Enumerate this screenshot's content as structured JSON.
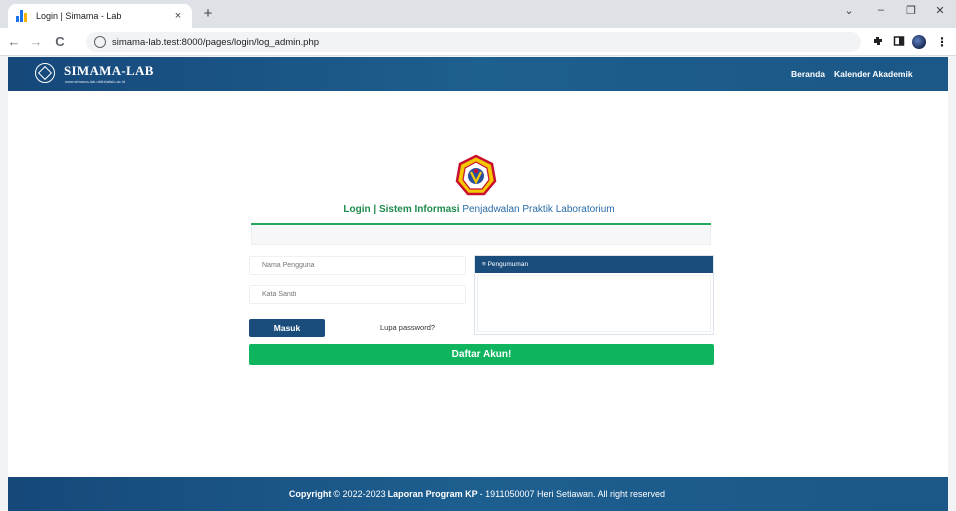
{
  "browser": {
    "tab_title": "Login | Simama - Lab",
    "tab_close": "×",
    "new_tab": "+",
    "url": "simama-lab.test:8000/pages/login/log_admin.php",
    "win_min": "–",
    "win_restore": "❐",
    "win_close": "✕",
    "win_chevron": "⌄",
    "nav_back": "←",
    "nav_forward": "→",
    "nav_reload": "C",
    "menu": "⋮"
  },
  "header": {
    "brand": "SIMAMA-LAB",
    "brand_sub": "www.simama-lab.uklinhafalo.ac.id",
    "nav": [
      "Beranda",
      "Kalender Akademik"
    ]
  },
  "login": {
    "heading_bold": "Login | Sistem Informasi",
    "heading_rest": "Penjadwalan Praktik Laboratorium",
    "username_placeholder": "Nama Pengguna",
    "password_placeholder": "Kata Sandi",
    "submit_label": "Masuk",
    "forgot_label": "Lupa password?",
    "register_label": "Daftar Akun!"
  },
  "announcement": {
    "title": "≡ Pengumuman"
  },
  "footer": {
    "copyright_bold": "Copyright",
    "copyright_mid": "© 2022-2023",
    "report_bold": "Laporan Program KP",
    "rest": "- 1911050007 Heri Setiawan. All right reserved"
  },
  "colors": {
    "brand_blue": "#1a4d7c",
    "register_green": "#0fb55e",
    "heading_green": "#1f8b4c",
    "heading_blue": "#2b6ba8"
  }
}
